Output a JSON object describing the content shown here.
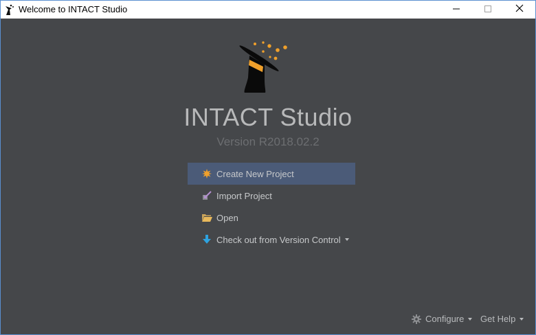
{
  "window": {
    "title": "Welcome to INTACT Studio",
    "controls": {
      "minimize": "minimize-icon",
      "maximize": "maximize-icon",
      "close": "close-icon"
    }
  },
  "welcome": {
    "app_name": "INTACT Studio",
    "version": "Version R2018.02.2",
    "actions": [
      {
        "label": "Create New Project",
        "icon": "new-project-star-icon",
        "selected": true
      },
      {
        "label": "Import Project",
        "icon": "import-project-icon",
        "selected": false
      },
      {
        "label": "Open",
        "icon": "folder-open-icon",
        "selected": false
      },
      {
        "label": "Check out from Version Control",
        "icon": "download-arrow-icon",
        "selected": false,
        "dropdown": true
      }
    ]
  },
  "footer": {
    "configure": "Configure",
    "get_help": "Get Help"
  },
  "colors": {
    "background": "#45474a",
    "selection": "#4b5b78",
    "accent_orange": "#f0a02b",
    "text": "#c7c9cb"
  }
}
